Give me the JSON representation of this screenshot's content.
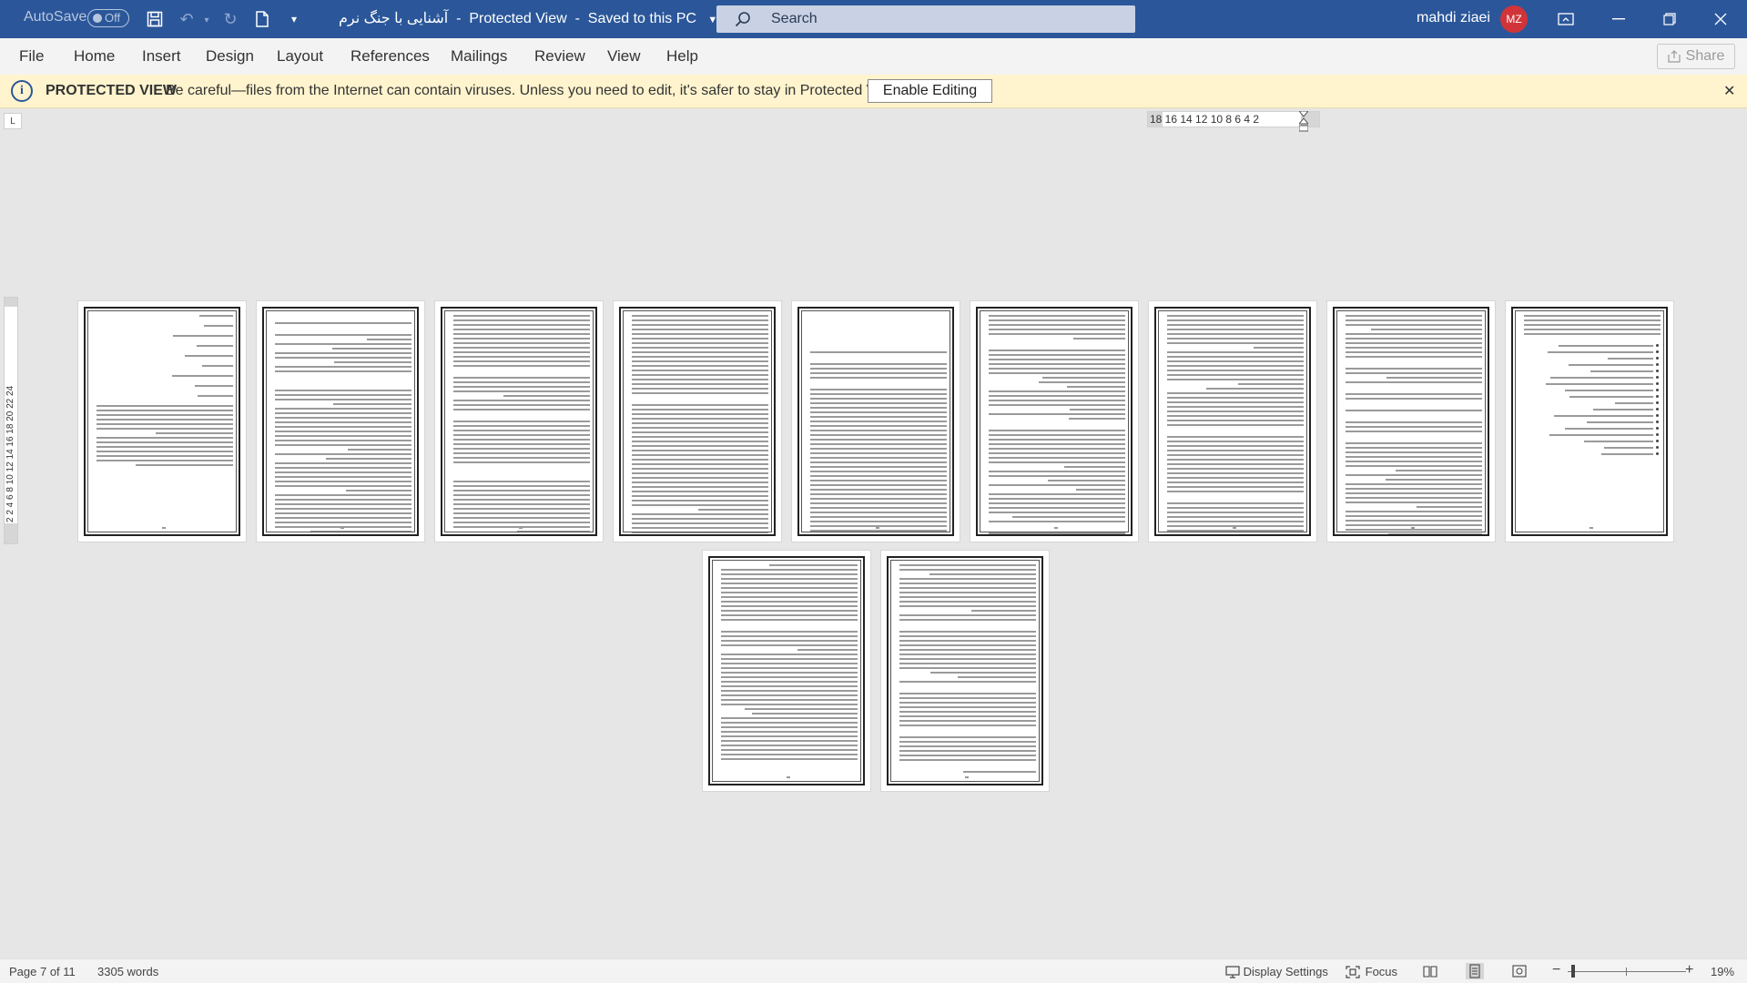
{
  "titlebar": {
    "autosave_label": "AutoSave",
    "autosave_state": "Off",
    "doc_name": "آشنایی با جنگ نرم",
    "separator": "-",
    "view_mode": "Protected View",
    "save_status": "Saved to this PC",
    "search_placeholder": "Search",
    "user_name": "mahdi ziaei",
    "user_initials": "MZ"
  },
  "menu": {
    "items": [
      "File",
      "Home",
      "Insert",
      "Design",
      "Layout",
      "References",
      "Mailings",
      "Review",
      "View",
      "Help"
    ],
    "share_label": "Share"
  },
  "protected_bar": {
    "title": "PROTECTED VIEW",
    "message": "Be careful—files from the Internet can contain viruses. Unless you need to edit, it's safer to stay in Protected View.",
    "button": "Enable Editing"
  },
  "ruler": {
    "corner": "L",
    "horizontal": "18 16 14 12 10  8  6  4  2",
    "vertical": "2  2  4  6  8 10 12 14 16 18 20 22 24"
  },
  "statusbar": {
    "page_info": "Page 7 of 11",
    "word_count": "3305 words",
    "display_settings": "Display Settings",
    "focus": "Focus",
    "zoom_minus": "−",
    "zoom_plus": "+",
    "zoom_level": "19%"
  },
  "colors": {
    "title_bar": "#2b579a",
    "protected_bar": "#fff4ce",
    "avatar": "#d13438"
  }
}
